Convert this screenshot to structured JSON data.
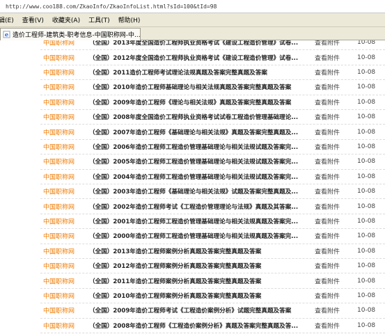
{
  "address_bar": {
    "url": "http://www.coo188.com/ZkaoInfo/ZkaoInfoList.html?sId=100&tId=98"
  },
  "menu": {
    "items": [
      {
        "key": "edit",
        "label": "辑(E)"
      },
      {
        "key": "view",
        "label": "查看(V)"
      },
      {
        "key": "favorites",
        "label": "收藏夹(A)"
      },
      {
        "key": "tools",
        "label": "工具(T)"
      },
      {
        "key": "help",
        "label": "帮助(H)"
      }
    ]
  },
  "tab": {
    "title": "造价工程师-建筑类-职考信息-中国职称网-中...",
    "icon": "ie-page-icon"
  },
  "list": {
    "rows": [
      {
        "source": "中国职称网",
        "title": "（全国）2013年度全国造价工程师执业资格考试《建设工程造价管理》试卷...",
        "attachment": "查看附件",
        "date": "10-08"
      },
      {
        "source": "中国职称网",
        "title": "（全国）2012年度全国造价工程师执业资格考试《建设工程造价管理》试卷...",
        "attachment": "查看附件",
        "date": "10-08"
      },
      {
        "source": "中国职称网",
        "title": "（全国）2011造价工程师考试理论法规真题及答案完整真题及答案",
        "attachment": "查看附件",
        "date": "10-08"
      },
      {
        "source": "中国职称网",
        "title": "（全国）2010年造价工程师基础理论与相关法规真题及答案完整真题及答案",
        "attachment": "查看附件",
        "date": "10-08"
      },
      {
        "source": "中国职称网",
        "title": "（全国）2009年造价工程师《理论与相关法规》真题及答案完整真题及答案",
        "attachment": "查看附件",
        "date": "10-08"
      },
      {
        "source": "中国职称网",
        "title": "（全国）2008年度全国造价工程师执业资格考试试卷工程造价管理基础理论...",
        "attachment": "查看附件",
        "date": "10-08"
      },
      {
        "source": "中国职称网",
        "title": "（全国）2007年造价工程师《基础理论与相关法规》真题及答案完整真题及...",
        "attachment": "查看附件",
        "date": "10-08"
      },
      {
        "source": "中国职称网",
        "title": "（全国）2006年造价工程师工程造价管理基础理论与相关法规试题及答案完...",
        "attachment": "查看附件",
        "date": "10-08"
      },
      {
        "source": "中国职称网",
        "title": "（全国）2005年造价工程师工程造价管理基础理论与相关法规试题及答案完...",
        "attachment": "查看附件",
        "date": "10-08"
      },
      {
        "source": "中国职称网",
        "title": "（全国）2004年造价工程师工程造价管理基础理论与相关法规试题及答案完...",
        "attachment": "查看附件",
        "date": "10-08"
      },
      {
        "source": "中国职称网",
        "title": "（全国）2003年造价工程师《基础理论与相关法规》试题及答案完整真题及...",
        "attachment": "查看附件",
        "date": "10-08"
      },
      {
        "source": "中国职称网",
        "title": "（全国）2002年造价工程师考试《工程造价管理理论与法规》真题及其答案...",
        "attachment": "查看附件",
        "date": "10-08"
      },
      {
        "source": "中国职称网",
        "title": "（全国）2001年造价工程师工程造价管理基础理论与相关法规真题及答案完...",
        "attachment": "查看附件",
        "date": "10-08"
      },
      {
        "source": "中国职称网",
        "title": "（全国）2000年造价工程师工程造价管理基础理论与相关法规真题及答案完...",
        "attachment": "查看附件",
        "date": "10-08"
      },
      {
        "source": "中国职称网",
        "title": "（全国）2013年造价工程师案例分析真题及答案完整真题及答案",
        "attachment": "查看附件",
        "date": "10-08"
      },
      {
        "source": "中国职称网",
        "title": "（全国）2012年造价工程师案例分析真题及答案完整真题及答案",
        "attachment": "查看附件",
        "date": "10-08"
      },
      {
        "source": "中国职称网",
        "title": "（全国）2011年造价工程师案例分析真题及答案完整真题及答案",
        "attachment": "查看附件",
        "date": "10-08"
      },
      {
        "source": "中国职称网",
        "title": "（全国）2010年造价工程师案例分析真题及答案完整真题及答案",
        "attachment": "查看附件",
        "date": "10-08"
      },
      {
        "source": "中国职称网",
        "title": "（全国）2009年造价工程师考试《工程造价案例分析》试题完整真题及答案",
        "attachment": "查看附件",
        "date": "10-08"
      },
      {
        "source": "中国职称网",
        "title": "（全国）2008年造价工程师《工程造价案例分析》真题及答案完整真题及答...",
        "attachment": "查看附件",
        "date": "10-08"
      }
    ]
  }
}
